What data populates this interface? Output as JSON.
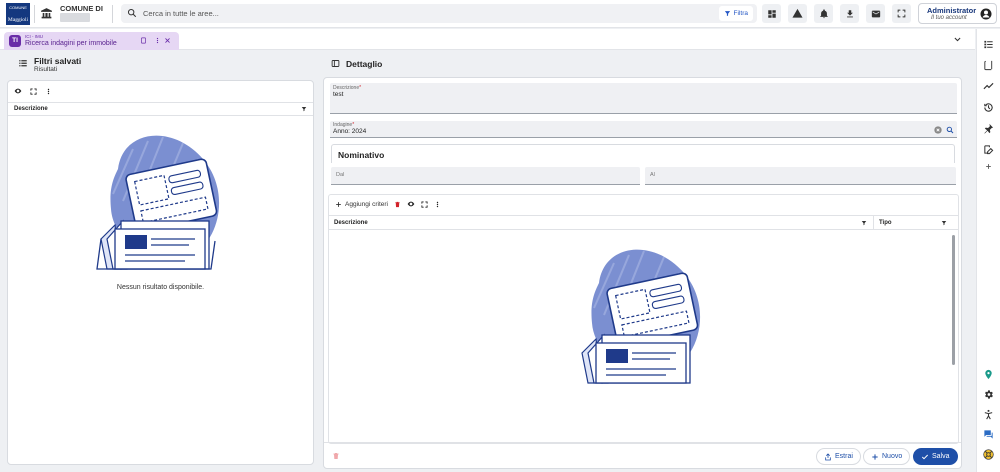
{
  "header": {
    "logo_top": "COMUNE",
    "logo_text": "Maggioli",
    "comune_label": "COMUNE DI",
    "search_placeholder": "Cerca in tutte le aree...",
    "filter_label": "Filtra",
    "user_name": "Administrator",
    "user_sub": "Il tuo account"
  },
  "tab": {
    "badge": "TI",
    "module": "ICI - IMU",
    "title": "Ricerca indagini per immobile"
  },
  "left_panel": {
    "title": "Filtri salvati",
    "subtitle": "Risultati",
    "column_header": "Descrizione",
    "empty_message": "Nessun risultato disponibile."
  },
  "right_panel": {
    "title": "Dettaglio",
    "descrizione_label": "Descrizione",
    "descrizione_value": "test",
    "indagine_label": "Indagine",
    "indagine_value": "Anno: 2024",
    "section_title": "Nominativo",
    "dal_placeholder": "Dal",
    "al_placeholder": "Al",
    "add_criteria_label": "Aggiungi criteri",
    "col_descrizione": "Descrizione",
    "col_tipo": "Tipo",
    "btn_estrai": "Estrai",
    "btn_nuovo": "Nuovo",
    "btn_salva": "Salva"
  },
  "colors": {
    "brand": "#1e4fa8",
    "tab_bg": "#e6d7f4",
    "tab_badge": "#6a2da8",
    "required": "#d2232a",
    "illustration_blob": "#7b8fd1"
  }
}
